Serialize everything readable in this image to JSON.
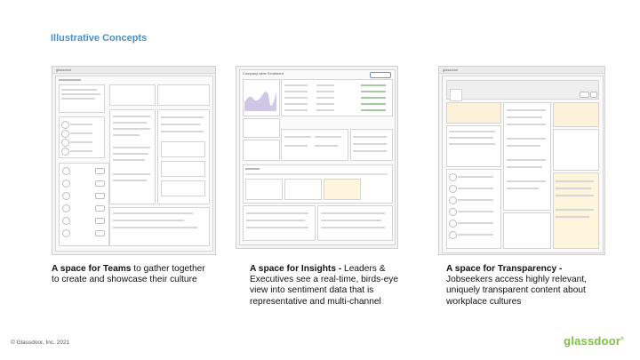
{
  "heading": "Illustrative Concepts",
  "panels": [
    {
      "id": "teams",
      "mockup_label": "glassdoor",
      "caption_bold": "A space for Teams",
      "caption_rest": " to gather together to create and showcase their culture"
    },
    {
      "id": "insights",
      "mockup_label": "Company-wide Sentiment",
      "caption_bold": "A space for Insights -",
      "caption_rest": " Leaders & Executives see a real-time, birds-eye view into sentiment data that is representative and multi-channel"
    },
    {
      "id": "transparency",
      "mockup_label": "glassdoor",
      "caption_bold": "A space for Transparency -",
      "caption_rest": " Jobseekers access highly relevant, uniquely transparent content about workplace cultures"
    }
  ],
  "footer": "© Glassdoor, Inc. 2021",
  "brand": "glassdoor",
  "brand_mark": "®",
  "colors": {
    "heading": "#4a90c8",
    "brand": "#7fc241"
  }
}
